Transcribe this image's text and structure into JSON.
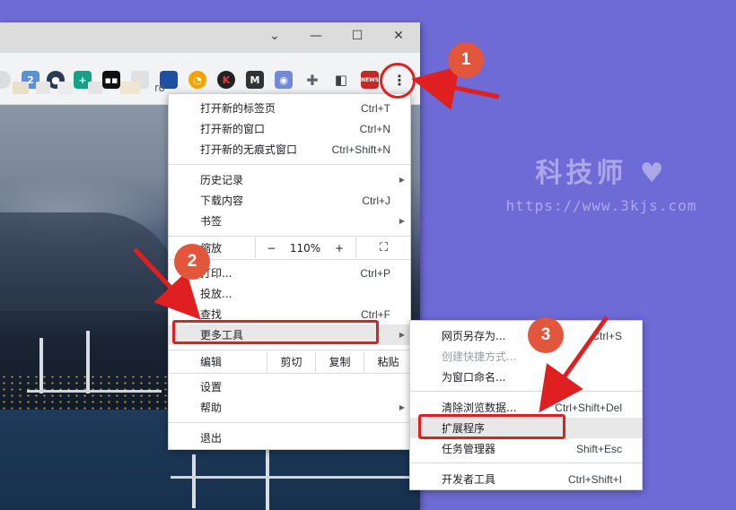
{
  "window_controls": {
    "dropdown": "⌄",
    "minimize": "—",
    "maximize": "☐",
    "close": "✕"
  },
  "url_fragment": "ro",
  "extensions": [
    "2",
    "K",
    "M",
    "NEWS"
  ],
  "main_menu": {
    "new_tab": {
      "label": "打开新的标签页",
      "shortcut": "Ctrl+T"
    },
    "new_window": {
      "label": "打开新的窗口",
      "shortcut": "Ctrl+N"
    },
    "incognito": {
      "label": "打开新的无痕式窗口",
      "shortcut": "Ctrl+Shift+N"
    },
    "history": {
      "label": "历史记录"
    },
    "downloads": {
      "label": "下载内容",
      "shortcut": "Ctrl+J"
    },
    "bookmarks": {
      "label": "书签"
    },
    "zoom": {
      "label": "缩放",
      "minus": "−",
      "value": "110%",
      "plus": "+"
    },
    "print": {
      "label": "打印...",
      "shortcut": "Ctrl+P"
    },
    "cast": {
      "label": "投放..."
    },
    "find": {
      "label": "查找",
      "shortcut": "Ctrl+F"
    },
    "more_tools": {
      "label": "更多工具"
    },
    "edit": {
      "label": "编辑",
      "cut": "剪切",
      "copy": "复制",
      "paste": "粘贴"
    },
    "settings": {
      "label": "设置"
    },
    "help": {
      "label": "帮助"
    },
    "exit": {
      "label": "退出"
    }
  },
  "sub_menu": {
    "save_page": {
      "label": "网页另存为...",
      "shortcut": "Ctrl+S"
    },
    "create_shortcut": {
      "label": "创建快捷方式..."
    },
    "name_window": {
      "label": "为窗口命名..."
    },
    "clear_data": {
      "label": "清除浏览数据...",
      "shortcut": "Ctrl+Shift+Del"
    },
    "extensions": {
      "label": "扩展程序"
    },
    "task_manager": {
      "label": "任务管理器",
      "shortcut": "Shift+Esc"
    },
    "dev_tools": {
      "label": "开发者工具",
      "shortcut": "Ctrl+Shift+I"
    }
  },
  "annotations": {
    "step1": "1",
    "step2": "2",
    "step3": "3"
  },
  "watermark": {
    "title": "科技师",
    "url": "https://www.3kjs.com"
  },
  "colors": {
    "accent_red": "#e02020",
    "badge": "#e2563b",
    "background": "#6e6ad6"
  }
}
